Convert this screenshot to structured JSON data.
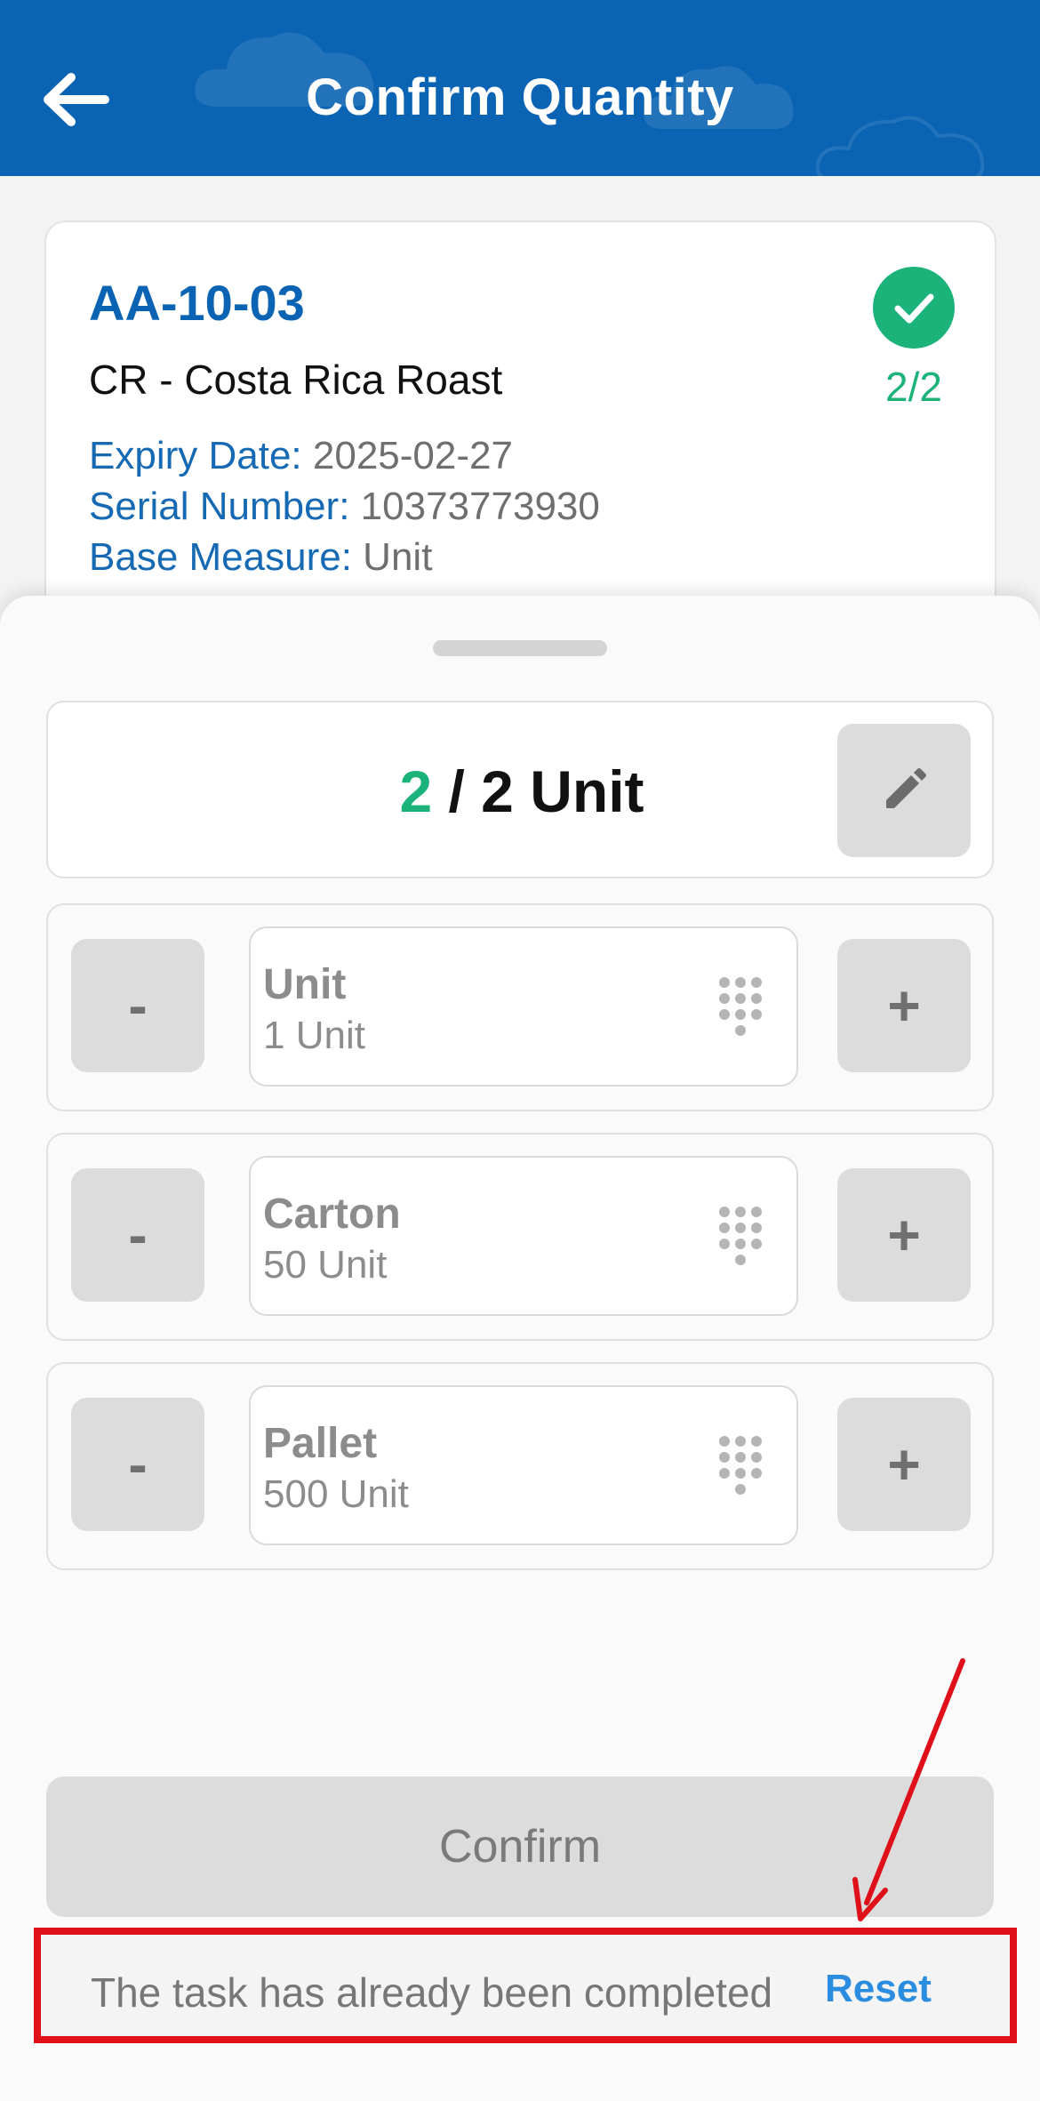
{
  "header": {
    "title": "Confirm Quantity"
  },
  "item": {
    "location": "AA-10-03",
    "name": "CR - Costa Rica Roast",
    "progress": "2/2",
    "meta": [
      {
        "key": "Expiry Date:",
        "value": "2025-02-27"
      },
      {
        "key": "Serial Number:",
        "value": "10373773930"
      },
      {
        "key": "Base Measure:",
        "value": "Unit"
      }
    ]
  },
  "total": {
    "current": "2",
    "rest": " / 2 Unit"
  },
  "uoms": [
    {
      "name": "Unit",
      "sub": "1 Unit",
      "minus": "-",
      "plus": "+"
    },
    {
      "name": "Carton",
      "sub": "50 Unit",
      "minus": "-",
      "plus": "+"
    },
    {
      "name": "Pallet",
      "sub": "500 Unit",
      "minus": "-",
      "plus": "+"
    }
  ],
  "confirm": {
    "label": "Confirm"
  },
  "status": {
    "text": "The task has already been completed",
    "reset_label": "Reset"
  },
  "colors": {
    "brand": "#0a63b3",
    "success": "#1bb37a",
    "annotation": "#e0101a",
    "link": "#2a8de0"
  },
  "icons": {
    "back": "arrow-left-icon",
    "check": "checkmark-icon",
    "edit": "pencil-icon",
    "keypad": "keypad-icon"
  }
}
